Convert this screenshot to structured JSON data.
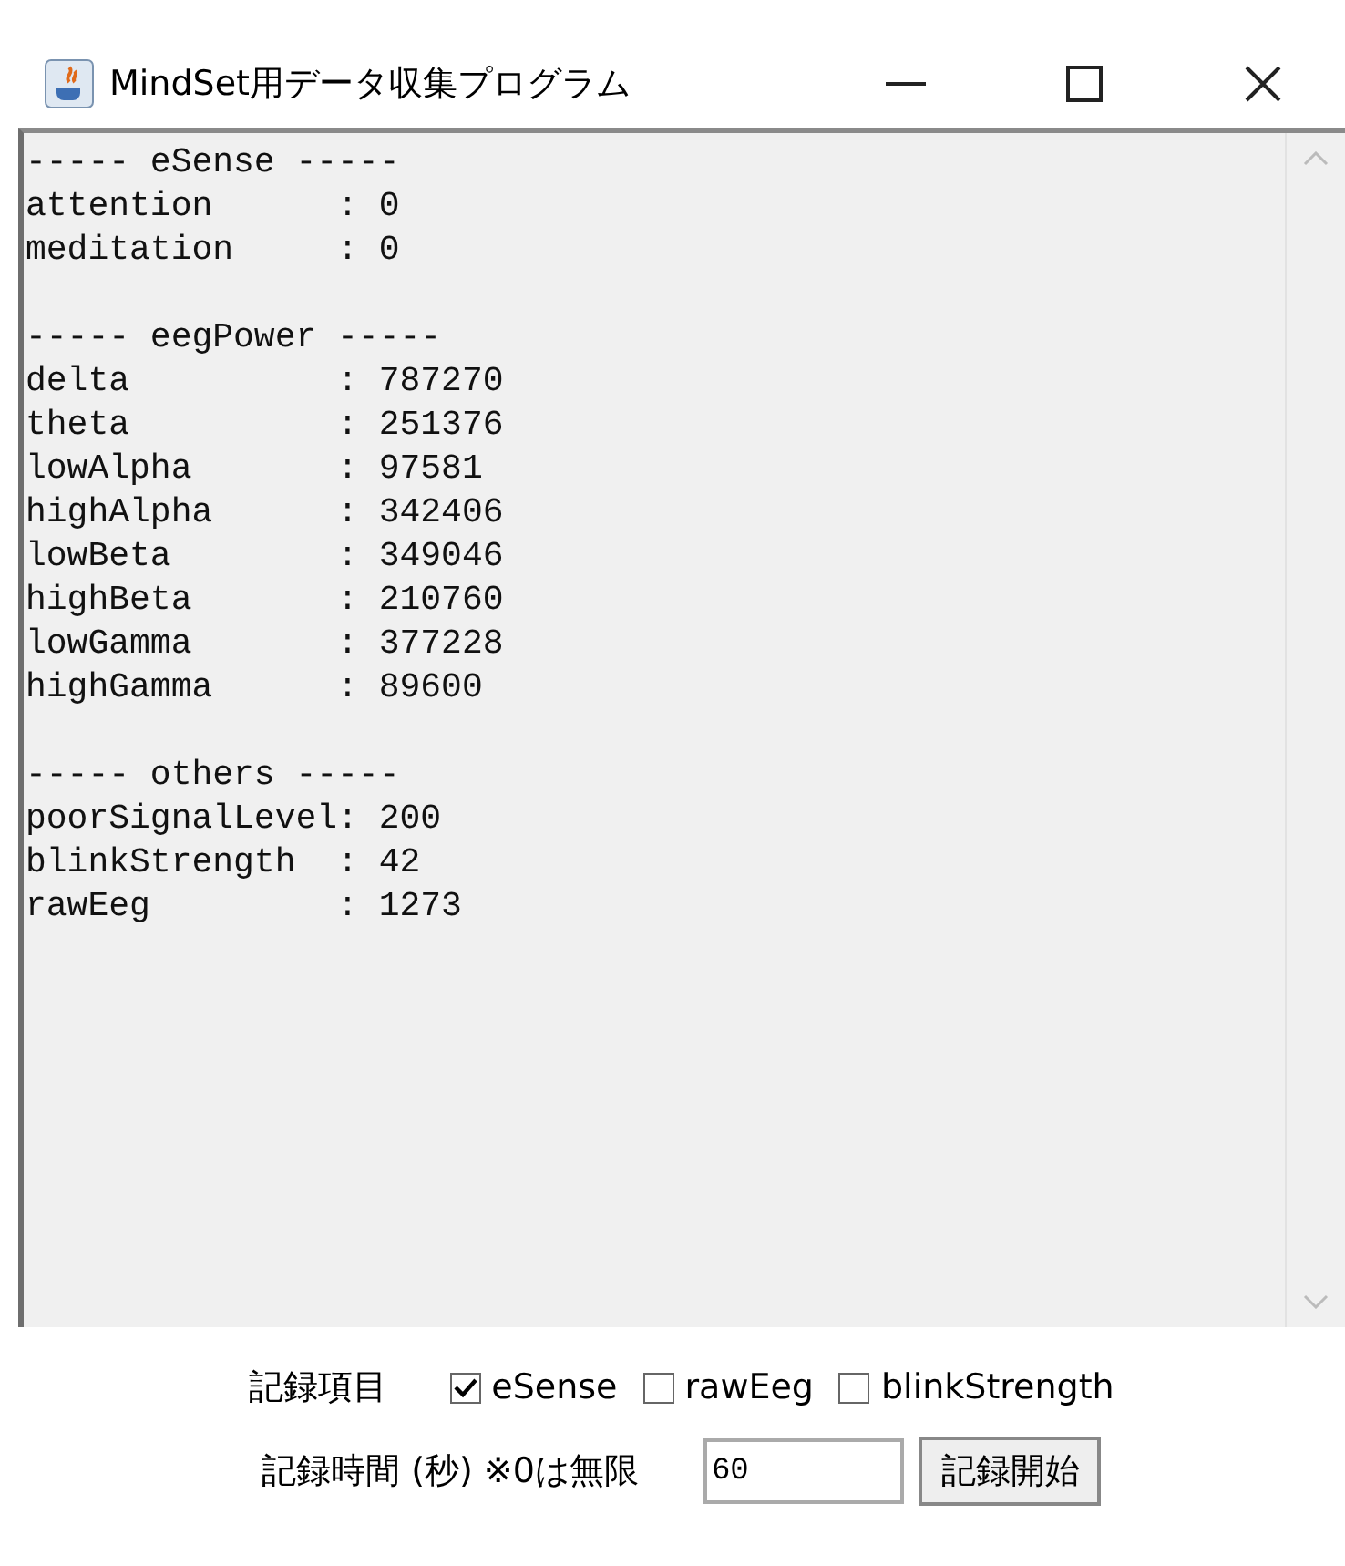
{
  "window": {
    "title": "MindSet用データ収集プログラム"
  },
  "output": {
    "sections": [
      {
        "heading": "----- eSense -----",
        "lines": [
          "attention      : 0",
          "meditation     : 0"
        ]
      },
      {
        "heading": "----- eegPower -----",
        "lines": [
          "delta          : 787270",
          "theta          : 251376",
          "lowAlpha       : 97581",
          "highAlpha      : 342406",
          "lowBeta        : 349046",
          "highBeta       : 210760",
          "lowGamma       : 377228",
          "highGamma      : 89600"
        ]
      },
      {
        "heading": "----- others -----",
        "lines": [
          "poorSignalLevel: 200",
          "blinkStrength  : 42",
          "rawEeg         : 1273"
        ]
      }
    ]
  },
  "record_items": {
    "label": "記録項目",
    "options": [
      {
        "label": "eSense",
        "checked": true
      },
      {
        "label": "rawEeg",
        "checked": false
      },
      {
        "label": "blinkStrength",
        "checked": false
      }
    ]
  },
  "record_time": {
    "label": "記録時間 (秒) ※0は無限",
    "value": "60",
    "button": "記録開始"
  }
}
